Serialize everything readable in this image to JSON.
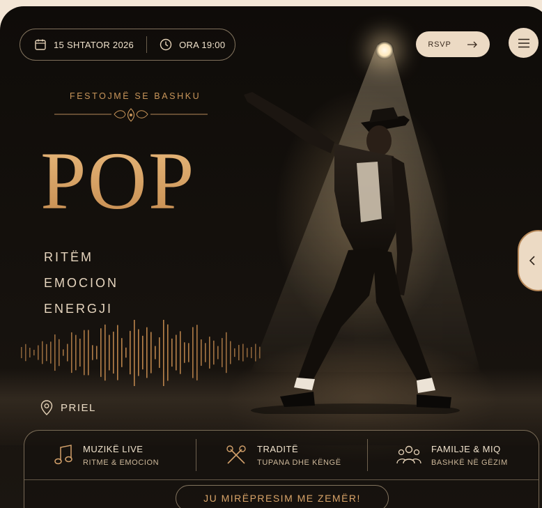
{
  "header": {
    "date": "15 SHTATOR 2026",
    "time": "ORA 19:00",
    "rsvp_label": "RSVP"
  },
  "hero": {
    "kicker": "FESTOJMË SE BASHKU",
    "title": "POP",
    "words": [
      "RITËM",
      "EMOCION",
      "ENERGJI"
    ],
    "location": "PRIEL"
  },
  "features": [
    {
      "title": "MUZIKË LIVE",
      "subtitle": "RITME & EMOCION",
      "icon": "music-note-icon"
    },
    {
      "title": "TRADITË",
      "subtitle": "TUPANA DHE KËNGË",
      "icon": "drumsticks-icon"
    },
    {
      "title": "FAMILJE & MIQ",
      "subtitle": "BASHKË NË GËZIM",
      "icon": "people-group-icon"
    }
  ],
  "welcome": "JU MIRËPRESIM ME ZEMËR!",
  "colors": {
    "accent": "#d7a265",
    "pill_bg": "#ecdac4",
    "background": "#13100c"
  }
}
